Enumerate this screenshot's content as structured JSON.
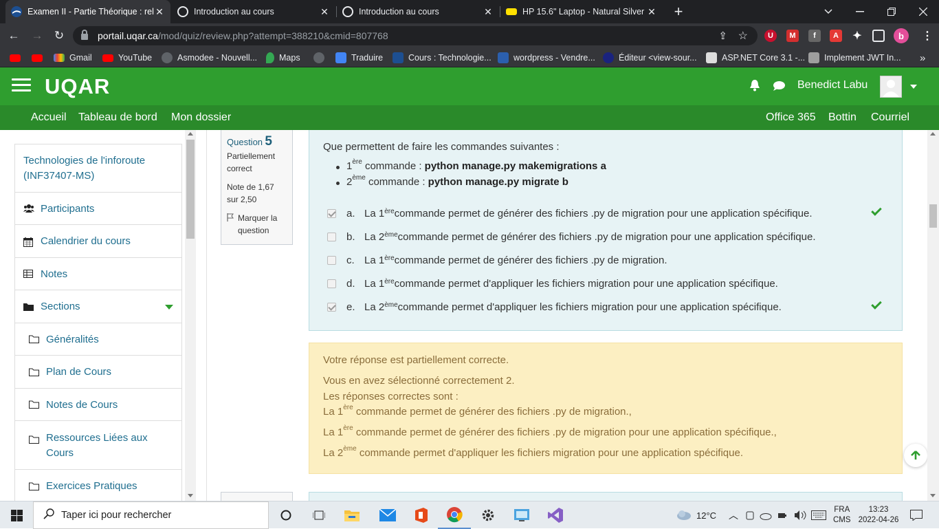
{
  "browser": {
    "tabs": [
      {
        "title": "Examen II - Partie Théorique : relecture",
        "active": true
      },
      {
        "title": "Introduction au cours",
        "active": false
      },
      {
        "title": "Introduction au cours",
        "active": false
      },
      {
        "title": "HP 15.6\" Laptop - Natural Silver (",
        "active": false
      }
    ],
    "new_tab": "+",
    "url_domain": "portail.uqar.ca",
    "url_path": "/mod/quiz/review.php?attempt=388210&cmid=807768",
    "profile_initial": "b",
    "bookmarks": [
      "",
      "",
      "Gmail",
      "YouTube",
      "Asmodee - Nouvell...",
      "Maps",
      "Traduire",
      "Cours : Technologie...",
      "wordpress - Vendre...",
      "Éditeur <view-sour...",
      "ASP.NET Core 3.1 -...",
      "Implement JWT In..."
    ],
    "bookmarks_more": "»"
  },
  "site": {
    "logo": "UQAR",
    "user_name": "Benedict Labu",
    "menu_left": [
      "Accueil",
      "Tableau de bord",
      "Mon dossier"
    ],
    "menu_right": [
      "Office 365",
      "Bottin",
      "Courriel"
    ]
  },
  "drawer": {
    "course_name": "Technologies de l'inforoute (INF37407-MS)",
    "items": [
      {
        "label": "Participants",
        "icon": "users-icon"
      },
      {
        "label": "Calendrier du cours",
        "icon": "calendar-icon"
      },
      {
        "label": "Notes",
        "icon": "table-icon"
      },
      {
        "label": "Sections",
        "icon": "folder-icon"
      }
    ],
    "sections": [
      "Généralités",
      "Plan de Cours",
      "Notes de Cours",
      "Ressources Liées aux Cours",
      "Exercices Pratiques"
    ]
  },
  "question": {
    "label": "Question",
    "number": "5",
    "state": "Partiellement correct",
    "grade": "Note de 1,67 sur 2,50",
    "flag": "Marquer la question",
    "text": "Que permettent de faire les commandes suivantes :",
    "commands": [
      {
        "n": "1",
        "sup": "ère",
        "mid": " commande : ",
        "cmd": "python manage.py makemigrations a"
      },
      {
        "n": "2",
        "sup": "ème",
        "mid": " commande : ",
        "cmd": "python manage.py migrate b"
      }
    ],
    "answers": [
      {
        "letter": "a.",
        "pre": "La 1",
        "sup": "ère",
        "text": " commande permet de générer des fichiers .py de migration pour une application spécifique.",
        "checked": true,
        "correct": true
      },
      {
        "letter": "b.",
        "pre": "La 2",
        "sup": "ème",
        "text": " commande permet de générer des fichiers .py de migration pour une application spécifique.",
        "checked": false,
        "correct": false
      },
      {
        "letter": "c.",
        "pre": "La 1",
        "sup": "ère",
        "text": " commande permet de générer des fichiers .py de migration.",
        "checked": false,
        "correct": false
      },
      {
        "letter": "d.",
        "pre": "La 1",
        "sup": "ère",
        "text": " commande permet d'appliquer les fichiers migration pour une application spécifique.",
        "checked": false,
        "correct": false
      },
      {
        "letter": "e.",
        "pre": "La 2",
        "sup": "ème",
        "text": " commande permet d'appliquer les fichiers migration pour une application spécifique.",
        "checked": true,
        "correct": true
      }
    ]
  },
  "feedback": {
    "status": "Votre réponse est partiellement correcte.",
    "selected": "Vous en avez sélectionné correctement 2.",
    "correct_header": "Les réponses correctes sont :",
    "correct_answers": [
      {
        "pre": "La 1",
        "sup": "ère",
        "text": " commande permet de générer des fichiers .py de migration.,"
      },
      {
        "pre": "La 1",
        "sup": "ère",
        "text": " commande permet de générer des fichiers .py de migration pour une application spécifique.,"
      },
      {
        "pre": "La 2",
        "sup": "ème",
        "text": " commande permet d'appliquer les fichiers migration pour une application spécifique."
      }
    ]
  },
  "taskbar": {
    "search_placeholder": "Taper ici pour rechercher",
    "weather": "12°C",
    "lang1": "FRA",
    "lang2": "CMS",
    "time": "13:23",
    "date": "2022-04-26"
  }
}
